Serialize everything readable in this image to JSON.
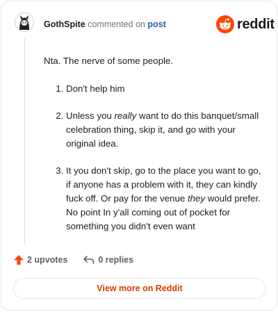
{
  "comment": {
    "author": "GothSpite",
    "action_text": "commented on",
    "post_link": "post",
    "intro": "Nta. The nerve of some people.",
    "list_items": [
      {
        "before": "Don't help him",
        "emphasis": "",
        "after": ""
      },
      {
        "before": "Unless you ",
        "emphasis": "really",
        "after": " want to do this banquet/small celebration thing, skip it, and go with your original idea."
      },
      {
        "before": "It you don't skip, go to the place you want to go, if anyone has a problem with it, they can kindly fuck off. Or pay for the venue ",
        "emphasis": "they",
        "after": " would prefer. No point In y'all coming out of pocket for something you didn't even want"
      }
    ]
  },
  "brand": {
    "name": "reddit",
    "icon": "reddit-logo-icon",
    "color": "#ff4500"
  },
  "footer": {
    "upvotes": "2 upvotes",
    "upvote_icon": "upvote-arrow-icon",
    "upvote_color": "#ff4500",
    "replies": "0 replies",
    "reply_icon": "reply-icon"
  },
  "cta": {
    "label": "View more on Reddit",
    "color": "#d93a00"
  }
}
